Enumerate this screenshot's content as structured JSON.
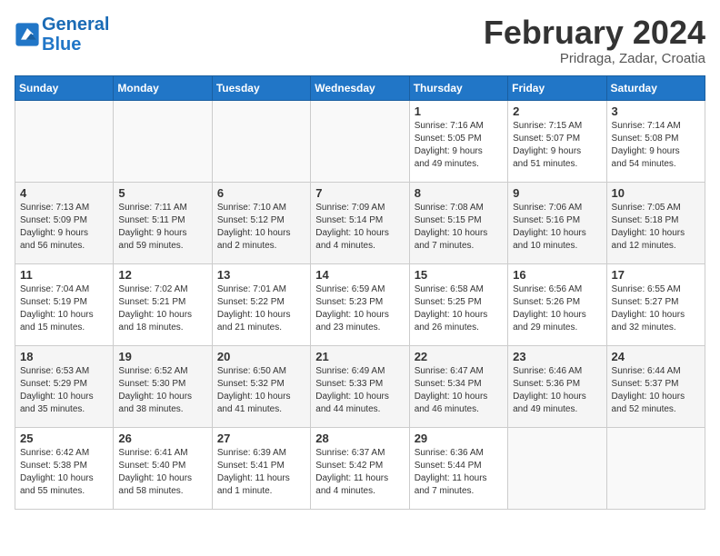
{
  "header": {
    "logo_line1": "General",
    "logo_line2": "Blue",
    "month_title": "February 2024",
    "location": "Pridraga, Zadar, Croatia"
  },
  "weekdays": [
    "Sunday",
    "Monday",
    "Tuesday",
    "Wednesday",
    "Thursday",
    "Friday",
    "Saturday"
  ],
  "weeks": [
    [
      {
        "day": "",
        "info": ""
      },
      {
        "day": "",
        "info": ""
      },
      {
        "day": "",
        "info": ""
      },
      {
        "day": "",
        "info": ""
      },
      {
        "day": "1",
        "info": "Sunrise: 7:16 AM\nSunset: 5:05 PM\nDaylight: 9 hours\nand 49 minutes."
      },
      {
        "day": "2",
        "info": "Sunrise: 7:15 AM\nSunset: 5:07 PM\nDaylight: 9 hours\nand 51 minutes."
      },
      {
        "day": "3",
        "info": "Sunrise: 7:14 AM\nSunset: 5:08 PM\nDaylight: 9 hours\nand 54 minutes."
      }
    ],
    [
      {
        "day": "4",
        "info": "Sunrise: 7:13 AM\nSunset: 5:09 PM\nDaylight: 9 hours\nand 56 minutes."
      },
      {
        "day": "5",
        "info": "Sunrise: 7:11 AM\nSunset: 5:11 PM\nDaylight: 9 hours\nand 59 minutes."
      },
      {
        "day": "6",
        "info": "Sunrise: 7:10 AM\nSunset: 5:12 PM\nDaylight: 10 hours\nand 2 minutes."
      },
      {
        "day": "7",
        "info": "Sunrise: 7:09 AM\nSunset: 5:14 PM\nDaylight: 10 hours\nand 4 minutes."
      },
      {
        "day": "8",
        "info": "Sunrise: 7:08 AM\nSunset: 5:15 PM\nDaylight: 10 hours\nand 7 minutes."
      },
      {
        "day": "9",
        "info": "Sunrise: 7:06 AM\nSunset: 5:16 PM\nDaylight: 10 hours\nand 10 minutes."
      },
      {
        "day": "10",
        "info": "Sunrise: 7:05 AM\nSunset: 5:18 PM\nDaylight: 10 hours\nand 12 minutes."
      }
    ],
    [
      {
        "day": "11",
        "info": "Sunrise: 7:04 AM\nSunset: 5:19 PM\nDaylight: 10 hours\nand 15 minutes."
      },
      {
        "day": "12",
        "info": "Sunrise: 7:02 AM\nSunset: 5:21 PM\nDaylight: 10 hours\nand 18 minutes."
      },
      {
        "day": "13",
        "info": "Sunrise: 7:01 AM\nSunset: 5:22 PM\nDaylight: 10 hours\nand 21 minutes."
      },
      {
        "day": "14",
        "info": "Sunrise: 6:59 AM\nSunset: 5:23 PM\nDaylight: 10 hours\nand 23 minutes."
      },
      {
        "day": "15",
        "info": "Sunrise: 6:58 AM\nSunset: 5:25 PM\nDaylight: 10 hours\nand 26 minutes."
      },
      {
        "day": "16",
        "info": "Sunrise: 6:56 AM\nSunset: 5:26 PM\nDaylight: 10 hours\nand 29 minutes."
      },
      {
        "day": "17",
        "info": "Sunrise: 6:55 AM\nSunset: 5:27 PM\nDaylight: 10 hours\nand 32 minutes."
      }
    ],
    [
      {
        "day": "18",
        "info": "Sunrise: 6:53 AM\nSunset: 5:29 PM\nDaylight: 10 hours\nand 35 minutes."
      },
      {
        "day": "19",
        "info": "Sunrise: 6:52 AM\nSunset: 5:30 PM\nDaylight: 10 hours\nand 38 minutes."
      },
      {
        "day": "20",
        "info": "Sunrise: 6:50 AM\nSunset: 5:32 PM\nDaylight: 10 hours\nand 41 minutes."
      },
      {
        "day": "21",
        "info": "Sunrise: 6:49 AM\nSunset: 5:33 PM\nDaylight: 10 hours\nand 44 minutes."
      },
      {
        "day": "22",
        "info": "Sunrise: 6:47 AM\nSunset: 5:34 PM\nDaylight: 10 hours\nand 46 minutes."
      },
      {
        "day": "23",
        "info": "Sunrise: 6:46 AM\nSunset: 5:36 PM\nDaylight: 10 hours\nand 49 minutes."
      },
      {
        "day": "24",
        "info": "Sunrise: 6:44 AM\nSunset: 5:37 PM\nDaylight: 10 hours\nand 52 minutes."
      }
    ],
    [
      {
        "day": "25",
        "info": "Sunrise: 6:42 AM\nSunset: 5:38 PM\nDaylight: 10 hours\nand 55 minutes."
      },
      {
        "day": "26",
        "info": "Sunrise: 6:41 AM\nSunset: 5:40 PM\nDaylight: 10 hours\nand 58 minutes."
      },
      {
        "day": "27",
        "info": "Sunrise: 6:39 AM\nSunset: 5:41 PM\nDaylight: 11 hours\nand 1 minute."
      },
      {
        "day": "28",
        "info": "Sunrise: 6:37 AM\nSunset: 5:42 PM\nDaylight: 11 hours\nand 4 minutes."
      },
      {
        "day": "29",
        "info": "Sunrise: 6:36 AM\nSunset: 5:44 PM\nDaylight: 11 hours\nand 7 minutes."
      },
      {
        "day": "",
        "info": ""
      },
      {
        "day": "",
        "info": ""
      }
    ]
  ]
}
